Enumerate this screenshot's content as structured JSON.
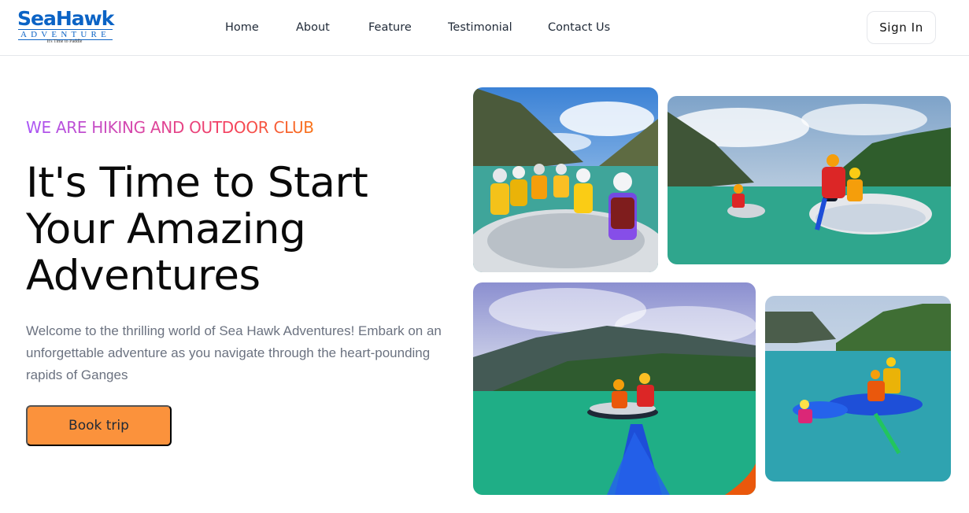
{
  "header": {
    "logo": {
      "word": "SeaHawk",
      "sub": "ADVENTURE",
      "tagline": "It's Time to Paddle"
    },
    "nav": [
      "Home",
      "About",
      "Feature",
      "Testimonial",
      "Contact Us"
    ],
    "signin_label": "Sign In"
  },
  "hero": {
    "eyebrow": "WE ARE HIKING AND OUTDOOR CLUB",
    "headline": "It's Time to Start Your Amazing Adventures",
    "description": "Welcome to the thrilling world of Sea Hawk Adventures! Embark on an unforgettable adventure as you navigate through the heart-pounding rapids of Ganges",
    "cta_label": "Book trip",
    "cta_color": "#fb923c",
    "eyebrow_gradient": [
      "#a855f7",
      "#f43f5e",
      "#f97316"
    ]
  },
  "gallery": {
    "photos": [
      {
        "name": "rafting-group-photo"
      },
      {
        "name": "raft-on-river-photo"
      },
      {
        "name": "kayak-view-photo"
      },
      {
        "name": "raft-celebration-photo"
      }
    ]
  }
}
